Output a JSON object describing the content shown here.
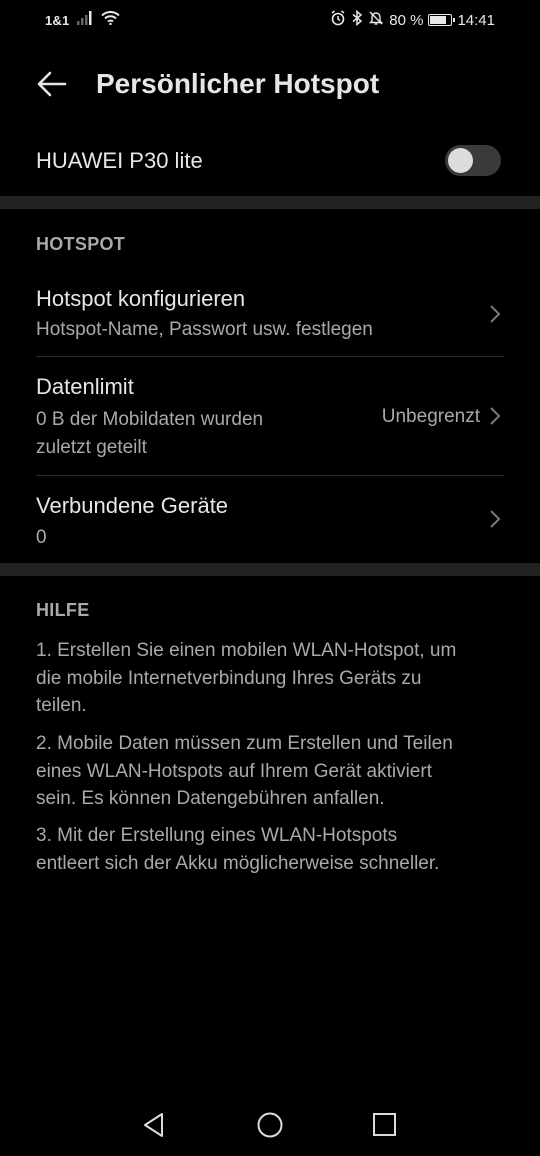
{
  "status_bar": {
    "carrier": "1&1",
    "battery_percent": "80 %",
    "battery_level": 0.8,
    "time": "14:41",
    "icons": [
      "signal-icon",
      "wifi-icon",
      "alarm-icon",
      "bluetooth-icon",
      "mute-icon",
      "battery-icon"
    ]
  },
  "header": {
    "back_icon": "arrow-left-icon",
    "title": "Persönlicher Hotspot"
  },
  "device": {
    "name": "HUAWEI P30 lite",
    "toggle_on": false
  },
  "hotspot_section": {
    "header": "HOTSPOT",
    "items": [
      {
        "title": "Hotspot konfigurieren",
        "subtitle": "Hotspot-Name, Passwort usw. festlegen",
        "value": ""
      },
      {
        "title": "Datenlimit",
        "subtitle_line1": "0 B der Mobildaten wurden",
        "subtitle_line2": "zuletzt geteilt",
        "value": "Unbegrenzt"
      },
      {
        "title": "Verbundene Geräte",
        "subtitle": "0",
        "value": ""
      }
    ]
  },
  "help_section": {
    "header": "HILFE",
    "paragraphs": [
      [
        "1. Erstellen Sie einen mobilen WLAN-Hotspot, um",
        "die mobile Internetverbindung Ihres Geräts zu",
        "teilen."
      ],
      [
        "2. Mobile Daten müssen zum Erstellen und Teilen",
        "eines WLAN-Hotspots auf Ihrem Gerät aktiviert",
        "sein. Es können Datengebühren anfallen."
      ],
      [
        "3. Mit der Erstellung eines WLAN-Hotspots",
        "entleert sich der Akku möglicherweise schneller."
      ]
    ]
  },
  "nav_bar": {
    "buttons": [
      "back-triangle-icon",
      "home-circle-icon",
      "recents-square-icon"
    ]
  },
  "colors": {
    "background": "#000000",
    "primary_text": "#e6e6e6",
    "secondary_text": "#a9a9a9",
    "separator": "#222222"
  }
}
